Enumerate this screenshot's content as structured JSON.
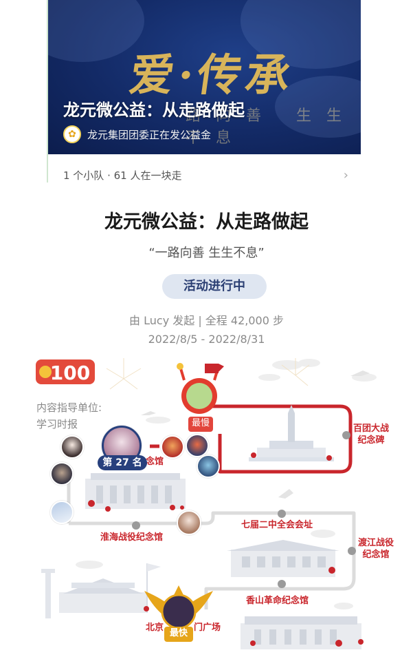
{
  "banner": {
    "calligraphy": "爱·传承",
    "subtitle": "路向善 生生不息",
    "title": "龙元微公益：从走路做起",
    "org_name": "龙元集团团委正在发公益金"
  },
  "team": {
    "summary": "1 个小队 · 61 人在一块走"
  },
  "activity": {
    "title": "龙元微公益：从走路做起",
    "slogan": "“一路向善 生生不息”",
    "status": "活动进行中",
    "meta": "由 Lucy 发起 | 全程 42,000 步",
    "dates": "2022/8/5 - 2022/8/31"
  },
  "map": {
    "logo_text": "100",
    "guide_label": "内容指导单位:",
    "guide_value": "学习时报",
    "places": {
      "baituan": "百团大战\n纪念碑",
      "jinian": "念馆",
      "huaihai": "淮海战役纪念馆",
      "qijie": "七届二中全会会址",
      "dujiang": "渡江战役\n纪念馆",
      "xiangshan": "香山革命纪念馆",
      "beijing_left": "北京",
      "beijing_right": "门广场"
    },
    "tags": {
      "slowest": "最慢",
      "rank": "第 27 名",
      "fastest": "最快"
    },
    "colors": {
      "route_red": "#c9262c",
      "route_gray": "#dcdcdc",
      "tag_red": "#e2453c",
      "tag_navy": "#27407d",
      "tag_gold": "#e6a51a"
    }
  }
}
